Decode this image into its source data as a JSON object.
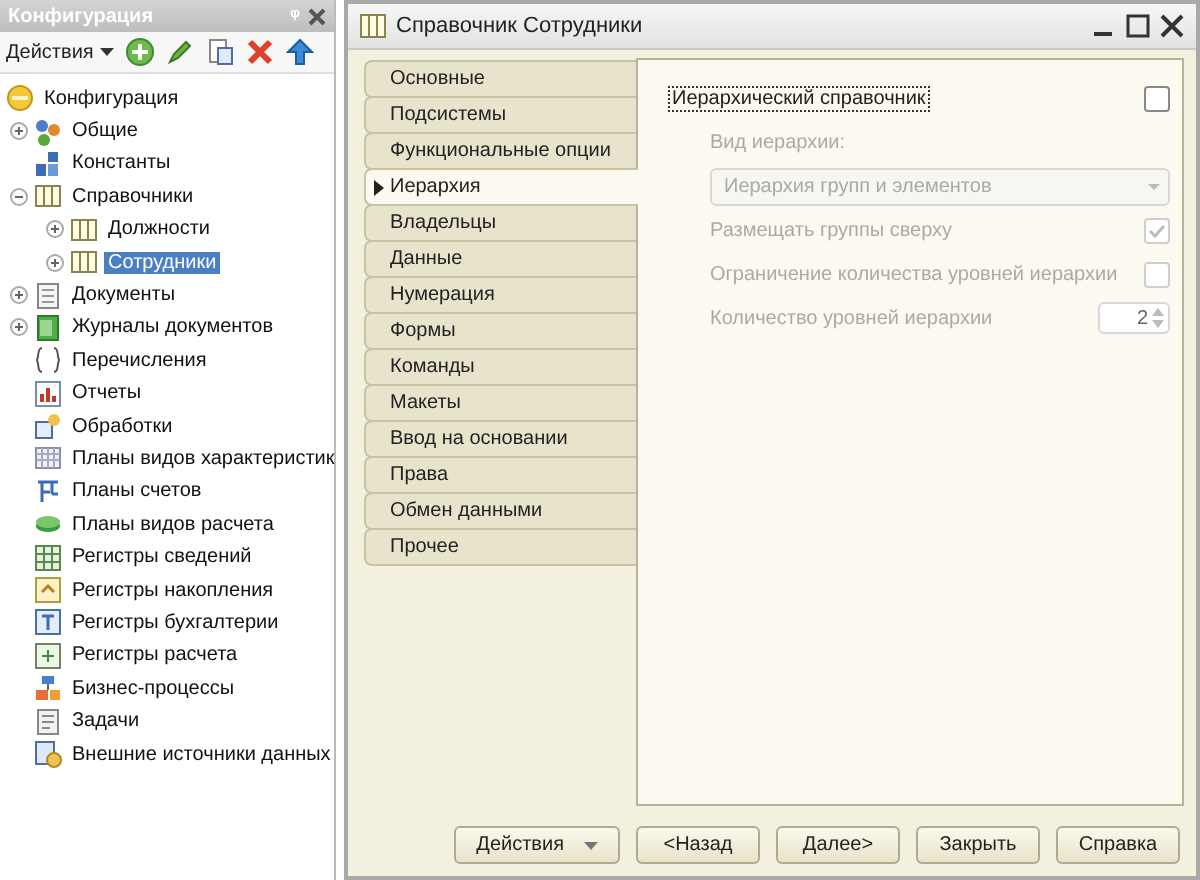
{
  "config_panel": {
    "title": "Конфигурация",
    "pin": "ᵠ",
    "actions": "Действия",
    "tree": [
      {
        "label": "Конфигурация",
        "selected": false,
        "children": [
          {
            "label": "Общие",
            "selected": false,
            "expanded": false
          },
          {
            "label": "Константы",
            "selected": false
          },
          {
            "label": "Справочники",
            "selected": false,
            "expanded": true,
            "children": [
              {
                "label": "Должности",
                "selected": false,
                "expanded": false
              },
              {
                "label": "Сотрудники",
                "selected": true,
                "expanded": false
              }
            ]
          },
          {
            "label": "Документы",
            "selected": false,
            "expanded": false
          },
          {
            "label": "Журналы документов",
            "selected": false,
            "expanded": false
          },
          {
            "label": "Перечисления",
            "selected": false
          },
          {
            "label": "Отчеты",
            "selected": false
          },
          {
            "label": "Обработки",
            "selected": false
          },
          {
            "label": "Планы видов характеристик",
            "selected": false
          },
          {
            "label": "Планы счетов",
            "selected": false
          },
          {
            "label": "Планы видов расчета",
            "selected": false
          },
          {
            "label": "Регистры сведений",
            "selected": false
          },
          {
            "label": "Регистры накопления",
            "selected": false
          },
          {
            "label": "Регистры бухгалтерии",
            "selected": false
          },
          {
            "label": "Регистры расчета",
            "selected": false
          },
          {
            "label": "Бизнес-процессы",
            "selected": false
          },
          {
            "label": "Задачи",
            "selected": false
          },
          {
            "label": "Внешние источники данных",
            "selected": false
          }
        ]
      }
    ]
  },
  "window": {
    "title": "Справочник Сотрудники",
    "tabs": [
      {
        "label": "Основные",
        "selected": false
      },
      {
        "label": "Подсистемы",
        "selected": false
      },
      {
        "label": "Функциональные опции",
        "selected": false
      },
      {
        "label": "Иерархия",
        "selected": true
      },
      {
        "label": "Владельцы",
        "selected": false
      },
      {
        "label": "Данные",
        "selected": false
      },
      {
        "label": "Нумерация",
        "selected": false
      },
      {
        "label": "Формы",
        "selected": false
      },
      {
        "label": "Команды",
        "selected": false
      },
      {
        "label": "Макеты",
        "selected": false
      },
      {
        "label": "Ввод на основании",
        "selected": false
      },
      {
        "label": "Права",
        "selected": false
      },
      {
        "label": "Обмен данными",
        "selected": false
      },
      {
        "label": "Прочее",
        "selected": false
      }
    ],
    "hierarchical": {
      "label": "Иерархический справочник",
      "checked": false,
      "focused": true
    },
    "options": [
      {
        "kind": "caption",
        "label": "Вид иерархии:",
        "disabled": true
      },
      {
        "kind": "dropdown",
        "value": "Иерархия групп и элементов",
        "disabled": true
      },
      {
        "kind": "checkbox",
        "label": "Размещать группы сверху",
        "checked": true,
        "disabled": true
      },
      {
        "kind": "checkbox",
        "label": "Ограничение количества уровней иерархии",
        "checked": false,
        "disabled": true
      },
      {
        "kind": "spin",
        "label": "Количество уровней иерархии",
        "value": "2",
        "disabled": true
      }
    ],
    "buttons": [
      {
        "label": "Действия",
        "kind": "menu"
      },
      {
        "label": "<Назад",
        "kind": "plain"
      },
      {
        "label": "Далее>",
        "kind": "plain"
      },
      {
        "label": "Закрыть",
        "kind": "plain"
      },
      {
        "label": "Справка",
        "kind": "plain"
      }
    ]
  }
}
